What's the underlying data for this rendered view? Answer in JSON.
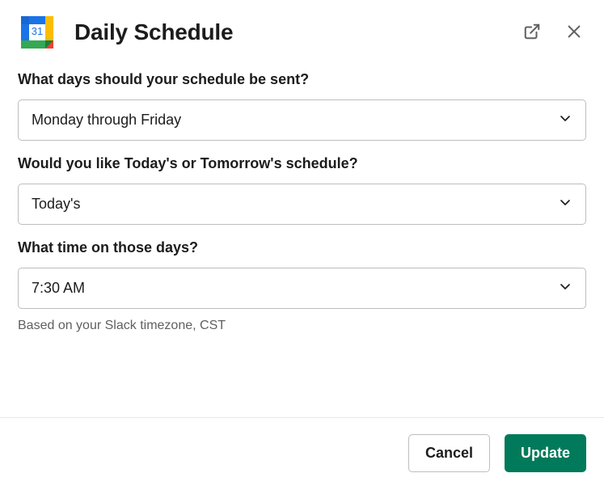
{
  "header": {
    "title": "Daily Schedule",
    "icon_day": "31"
  },
  "fields": {
    "days": {
      "label": "What days should your schedule be sent?",
      "value": "Monday through Friday"
    },
    "today_or_tomorrow": {
      "label": "Would you like Today's or Tomorrow's schedule?",
      "value": "Today's"
    },
    "time": {
      "label": "What time on those days?",
      "value": "7:30 AM",
      "helper": "Based on your Slack timezone, CST"
    }
  },
  "footer": {
    "cancel_label": "Cancel",
    "update_label": "Update"
  }
}
